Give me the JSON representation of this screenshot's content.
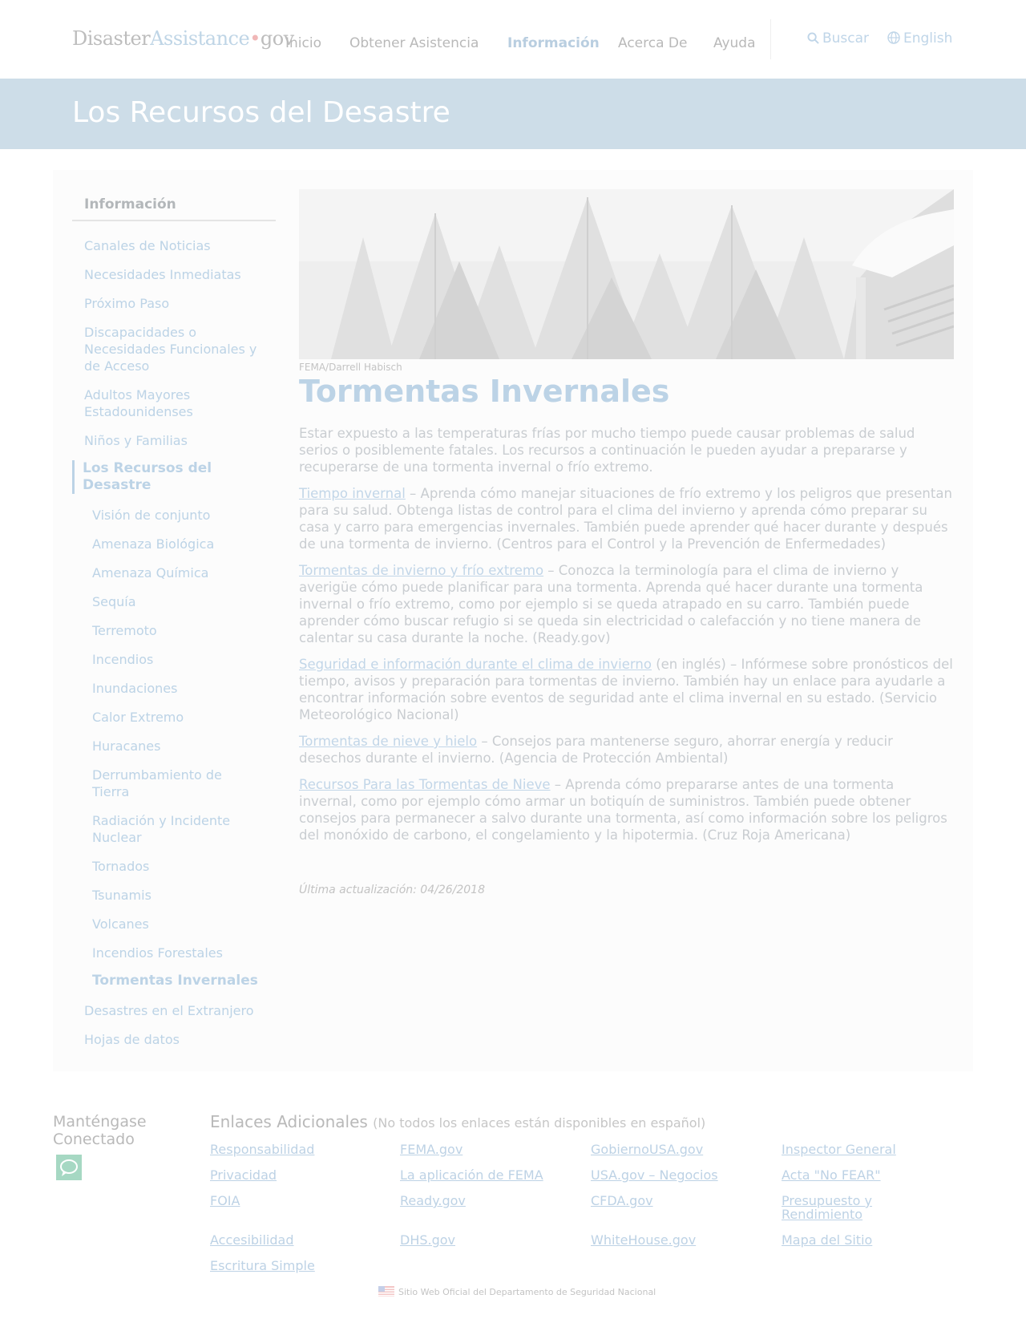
{
  "header": {
    "logo": {
      "part1": "Disaster",
      "part2": "Assistance",
      "dot": "•",
      "part3": "gov"
    },
    "nav": [
      {
        "label": "Inicio"
      },
      {
        "label": "Obtener Asistencia"
      },
      {
        "label": "Información",
        "active": true
      },
      {
        "label": "Acerca De"
      },
      {
        "label": "Ayuda"
      }
    ],
    "search_label": "Buscar",
    "language_label": "English"
  },
  "banner": {
    "title": "Los Recursos del Desastre"
  },
  "sidebar": {
    "heading": "Información",
    "items": [
      "Canales de Noticias",
      "Necesidades Inmediatas",
      "Próximo Paso",
      "Discapacidades o Necesidades Funcionales y de Acceso",
      "Adultos Mayores Estadounidenses",
      "Niños y Familias",
      "Los Recursos del Desastre",
      "Visión de conjunto",
      "Amenaza Biológica",
      "Amenaza Química",
      "Sequía",
      "Terremoto",
      "Incendios",
      "Inundaciones",
      "Calor Extremo",
      "Huracanes",
      "Derrumbamiento de Tierra",
      "Radiación y Incidente Nuclear",
      "Tornados",
      "Tsunamis",
      "Volcanes",
      "Incendios Forestales",
      "Tormentas Invernales",
      "Desastres en el Extranjero",
      "Hojas de datos"
    ]
  },
  "content": {
    "image_caption": "FEMA/Darrell Habisch",
    "title": "Tormentas Invernales",
    "intro": "Estar expuesto a las temperaturas frías por mucho tiempo puede causar problemas de salud serios o posiblemente fatales. Los recursos a continuación le pueden ayudar a prepararse y recuperarse de una tormenta invernal o frío extremo.",
    "resources": [
      {
        "link": "Tiempo invernal",
        "text": " – Aprenda cómo manejar situaciones de frío extremo y los peligros que presentan para su salud. Obtenga listas de control para el clima del invierno y aprenda cómo preparar su casa y carro para emergencias invernales. También puede aprender qué hacer durante y después de una tormenta de invierno. (Centros para el Control y la Prevención de Enfermedades)"
      },
      {
        "link": "Tormentas de invierno y frío extremo",
        "text": " – Conozca la terminología para el clima de invierno y averigüe cómo puede planificar para una tormenta. Aprenda qué hacer durante una tormenta invernal o frío extremo, como por ejemplo si se queda atrapado en su carro. También puede aprender cómo buscar refugio si se queda sin electricidad o calefacción y no tiene manera de calentar su casa durante la noche. (Ready.gov)"
      },
      {
        "link": "Seguridad e información durante el clima de invierno",
        "text": " (en inglés) – Infórmese sobre pronósticos del tiempo, avisos y preparación para tormentas de invierno. También hay un enlace para ayudarle a encontrar información sobre eventos de seguridad ante el clima invernal en su estado. (Servicio Meteorológico Nacional)"
      },
      {
        "link": "Tormentas de nieve y hielo",
        "text": " – Consejos para mantenerse seguro, ahorrar energía y reducir desechos durante el invierno. (Agencia de Protección Ambiental)"
      },
      {
        "link": "Recursos Para las Tormentas de Nieve",
        "text": " – Aprenda cómo prepararse antes de una tormenta invernal, como por ejemplo cómo armar un botiquín de suministros. También puede obtener consejos para permanecer a salvo durante una tormenta, así como información sobre los peligros del monóxido de carbono, el congelamiento y la hipotermia. (Cruz Roja Americana)"
      }
    ],
    "last_updated": "Última actualización: 04/26/2018"
  },
  "footer": {
    "connect_heading": "Manténgase Conectado",
    "links_heading": "Enlaces Adicionales",
    "links_note": "(No todos los enlaces están disponibles en español)",
    "links": [
      "Responsabilidad",
      "FEMA.gov",
      "GobiernoUSA.gov",
      "Inspector General",
      "Privacidad",
      "La aplicación de FEMA",
      "USA.gov – Negocios",
      "Acta \"No FEAR\"",
      "FOIA",
      "Ready.gov",
      "CFDA.gov",
      "Presupuesto y Rendimiento",
      "Accesibilidad",
      "DHS.gov",
      "WhiteHouse.gov",
      "Mapa del Sitio",
      "Escritura Simple"
    ],
    "official_note": "Sitio Web Oficial del Departamento de Seguridad Nacional"
  }
}
